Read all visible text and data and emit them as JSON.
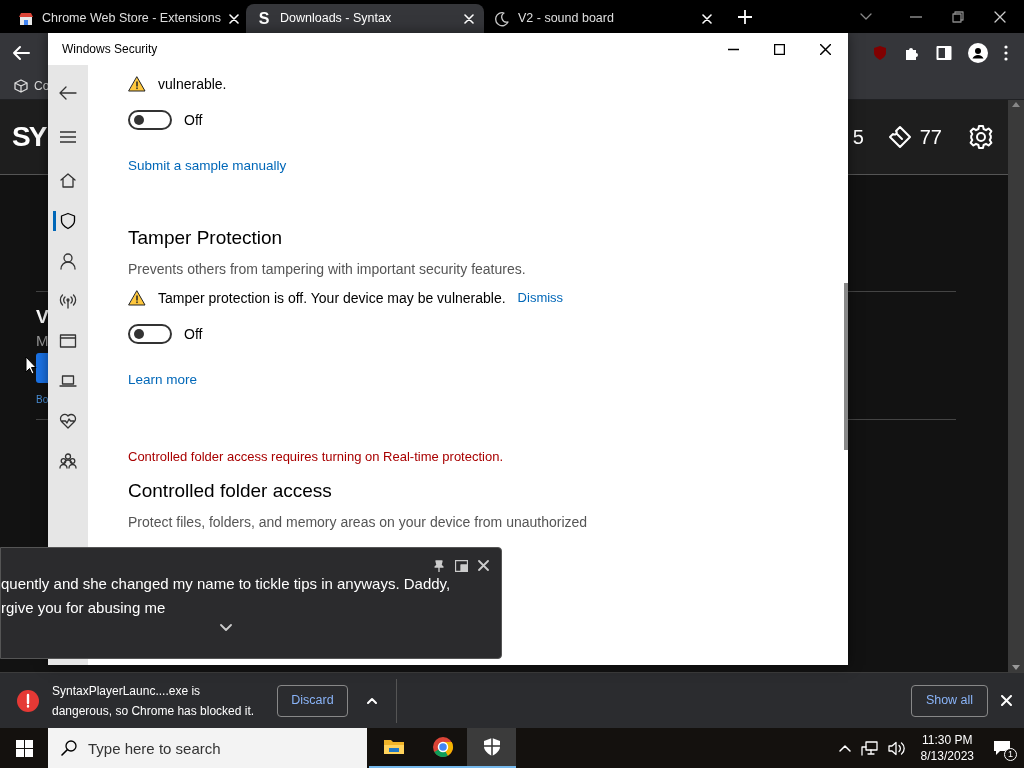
{
  "browser": {
    "tabs": [
      {
        "title": "Chrome Web Store - Extensions",
        "kind": "store",
        "selected": false
      },
      {
        "title": "Downloads - Syntax",
        "kind": "letter",
        "favicon": "S",
        "selected": true
      },
      {
        "title": "V2 - sound board",
        "kind": "moon",
        "selected": false
      }
    ],
    "bookmarks": [
      {
        "label": "Co"
      }
    ],
    "page": {
      "logo": "SY",
      "stats": [
        {
          "kind": "coins",
          "value": "5"
        },
        {
          "kind": "tickets",
          "value": "77"
        }
      ],
      "item_title": "V",
      "item_subtitle": "M",
      "item_link": "Bo"
    }
  },
  "security_window": {
    "title": "Windows Security",
    "nav": [
      {
        "kind": "home",
        "selected": false
      },
      {
        "kind": "shield",
        "selected": true
      },
      {
        "kind": "account",
        "selected": false
      },
      {
        "kind": "network",
        "selected": false
      },
      {
        "kind": "app",
        "selected": false
      },
      {
        "kind": "device",
        "selected": false
      },
      {
        "kind": "health",
        "selected": false
      },
      {
        "kind": "family",
        "selected": false
      }
    ],
    "sections": [
      {
        "warning": {
          "text": "vulnerable."
        },
        "toggle": {
          "on": false,
          "label": "Off"
        },
        "link": "Submit a sample manually"
      },
      {
        "heading": "Tamper Protection",
        "description": "Prevents others from tampering with important security features.",
        "warning": {
          "text": "Tamper protection is off. Your device may be vulnerable.",
          "action": "Dismiss"
        },
        "toggle": {
          "on": false,
          "label": "Off"
        },
        "link": "Learn more"
      },
      {
        "error": "Controlled folder access requires turning on Real-time protection.",
        "heading": "Controlled folder access",
        "description": "Protect files, folders, and memory areas on your device from unauthorized"
      }
    ]
  },
  "caption_popup": {
    "lines": [
      "quently and she changed my name to tickle tips in anyways. Daddy,",
      "rgive you for abusing me"
    ]
  },
  "download_bar": {
    "message_lines": [
      "SyntaxPlayerLaunc....exe is",
      "dangerous, so Chrome has blocked it."
    ],
    "discard": "Discard",
    "show_all": "Show all"
  },
  "taskbar": {
    "search_placeholder": "Type here to search",
    "apps": [
      {
        "kind": "explorer",
        "active": false
      },
      {
        "kind": "browser",
        "active": false
      },
      {
        "kind": "security",
        "active": true
      }
    ],
    "time": "11:30 PM",
    "date": "8/13/2023",
    "notifications": "1"
  }
}
